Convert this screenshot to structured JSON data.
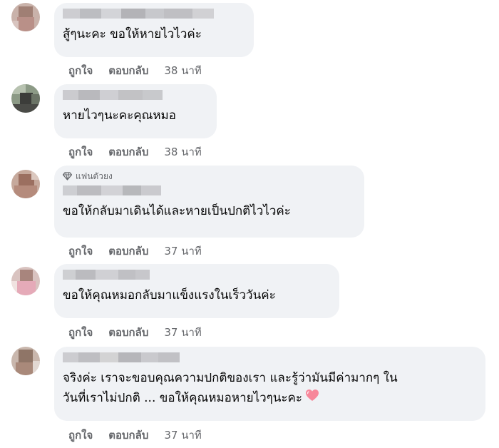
{
  "comments": [
    {
      "name": "",
      "badge": "",
      "text": "สู้ๆนะคะ ขอให้หายไวไวค่ะ",
      "like_label": "ถูกใจ",
      "reply_label": "ตอบกลับ",
      "time": "38 นาที"
    },
    {
      "name": "",
      "badge": "",
      "text": "หายไวๆนะคะคุณหมอ",
      "like_label": "ถูกใจ",
      "reply_label": "ตอบกลับ",
      "time": "38 นาที"
    },
    {
      "name": "",
      "badge": "แฟนตัวยง",
      "text": "ขอให้กลับมาเดินได้และหายเป็นปกติไวไวค่ะ",
      "like_label": "ถูกใจ",
      "reply_label": "ตอบกลับ",
      "time": "37 นาที"
    },
    {
      "name": "",
      "badge": "",
      "text": "ขอให้คุณหมอกลับมาแข็งแรงในเร็ววันค่ะ",
      "like_label": "ถูกใจ",
      "reply_label": "ตอบกลับ",
      "time": "37 นาที"
    },
    {
      "name": "",
      "badge": "",
      "text_line1": "จริงค่ะ เราจะขอบคุณความปกติของเรา และรู้ว่ามันมีค่ามากๆ ใน",
      "text_line2": "วันที่เราไม่ปกติ ... ขอให้คุณหมอหายไวๆนะคะ",
      "like_label": "ถูกใจ",
      "reply_label": "ตอบกลับ",
      "time": "37 นาที"
    }
  ],
  "colors": {
    "bubble": "#f0f2f5",
    "meta_text": "#65676b",
    "body_text": "#050505",
    "heart": "#f7879a"
  },
  "icons": {
    "badge_icon": "diamond-icon",
    "emoji": "pink-heart-emoji"
  }
}
